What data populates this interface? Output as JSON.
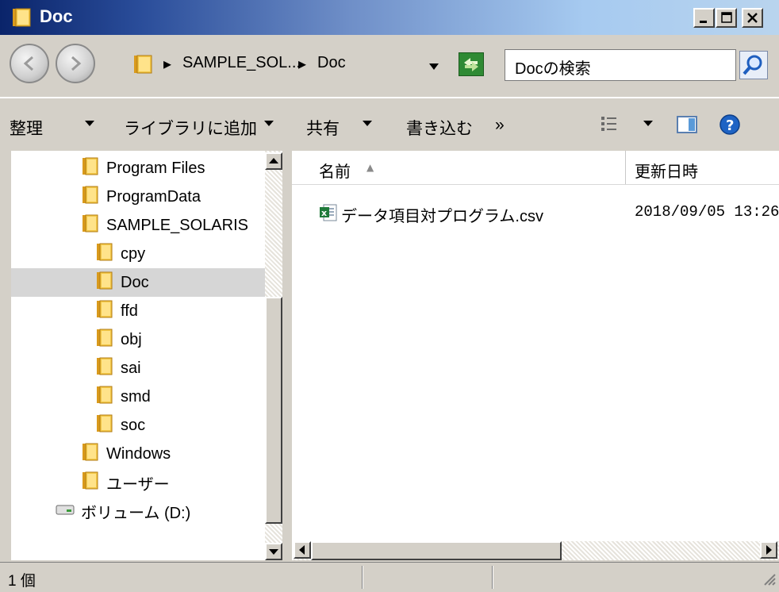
{
  "window": {
    "title": "Doc"
  },
  "address": {
    "segments": [
      "SAMPLE_SOL...",
      "Doc"
    ],
    "separator": "▸",
    "search_placeholder": "Docの検索"
  },
  "toolbar": {
    "items": [
      {
        "label": "整理",
        "has_dropdown": true
      },
      {
        "label": "ライブラリに追加",
        "has_dropdown": true
      },
      {
        "label": "共有",
        "has_dropdown": true
      },
      {
        "label": "書き込む",
        "has_dropdown": false
      },
      {
        "label": "»",
        "has_dropdown": false
      }
    ]
  },
  "nav_tree": {
    "items": [
      {
        "label": "Program Files",
        "icon": "folder-icon",
        "indent": 1
      },
      {
        "label": "ProgramData",
        "icon": "folder-icon",
        "indent": 1
      },
      {
        "label": "SAMPLE_SOLARIS",
        "icon": "folder-icon",
        "indent": 1
      },
      {
        "label": "cpy",
        "icon": "folder-icon",
        "indent": 2
      },
      {
        "label": "Doc",
        "icon": "folder-icon",
        "indent": 2,
        "selected": true
      },
      {
        "label": "ffd",
        "icon": "folder-icon",
        "indent": 2
      },
      {
        "label": "obj",
        "icon": "folder-icon",
        "indent": 2
      },
      {
        "label": "sai",
        "icon": "folder-icon",
        "indent": 2
      },
      {
        "label": "smd",
        "icon": "folder-icon",
        "indent": 2
      },
      {
        "label": "soc",
        "icon": "folder-icon",
        "indent": 2
      },
      {
        "label": "Windows",
        "icon": "folder-icon",
        "indent": 1
      },
      {
        "label": "ユーザー",
        "icon": "folder-icon",
        "indent": 1
      },
      {
        "label": "ボリューム (D:)",
        "icon": "drive-icon",
        "indent": 0
      }
    ]
  },
  "file_list": {
    "columns": [
      "名前",
      "更新日時"
    ],
    "sort_indicator": "▲",
    "rows": [
      {
        "name": "データ項目対プログラム.csv",
        "modified": "2018/09/05 13:26",
        "icon": "excel-csv-icon"
      }
    ]
  },
  "status": {
    "item_count": "1 個"
  },
  "colors": {
    "title_start": "#0a246a",
    "title_end": "#a6caf0",
    "face": "#d4d0c8",
    "folder": "#f0c040",
    "selected_row": "#d6d6d6"
  }
}
